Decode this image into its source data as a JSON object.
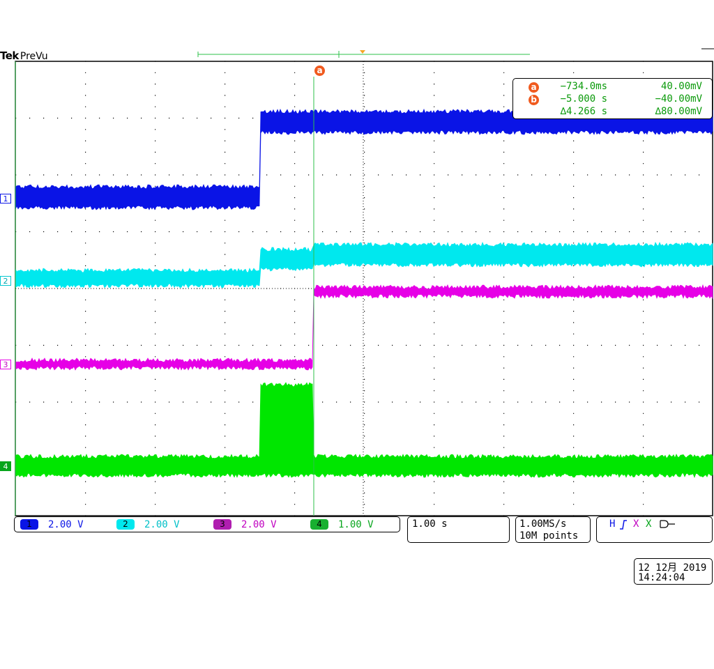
{
  "brand": {
    "name": "Tek",
    "mode": "PreVu"
  },
  "colors": {
    "ch1": "#0a14e6",
    "ch2": "#00e8ee",
    "ch3": "#e600e6",
    "ch4": "#00e600",
    "ch4_label": "#07a51c",
    "cursor": "#2cc24a",
    "cursor_tag": "#f05a1e",
    "trigger": "#f5a623",
    "grid": "#000000"
  },
  "cursors": {
    "a": {
      "tag": "a",
      "time": "−734.0ms",
      "value": "40.00mV"
    },
    "b": {
      "tag": "b",
      "time": "−5.000 s",
      "value": "−40.00mV"
    },
    "delta": {
      "time": "∆4.266 s",
      "value": "∆80.00mV"
    }
  },
  "channels": [
    {
      "num": "1",
      "scale": "2.00 V",
      "icon": "ch1-marker"
    },
    {
      "num": "2",
      "scale": "2.00 V",
      "icon": "ch2-marker"
    },
    {
      "num": "3",
      "scale": "2.00 V",
      "icon": "ch3-marker"
    },
    {
      "num": "4",
      "scale": "1.00 V",
      "icon": "ch4-marker"
    }
  ],
  "timebase": {
    "scale": "1.00 s"
  },
  "sampling": {
    "rate": "1.00MS/s",
    "points": "10M points"
  },
  "trigger": {
    "labels": [
      "H",
      "X",
      "X"
    ],
    "icons": [
      "rising-edge-icon",
      "ground-symbol-icon"
    ]
  },
  "datetime": {
    "date": "12 12月 2019",
    "time": "14:24:04"
  }
}
